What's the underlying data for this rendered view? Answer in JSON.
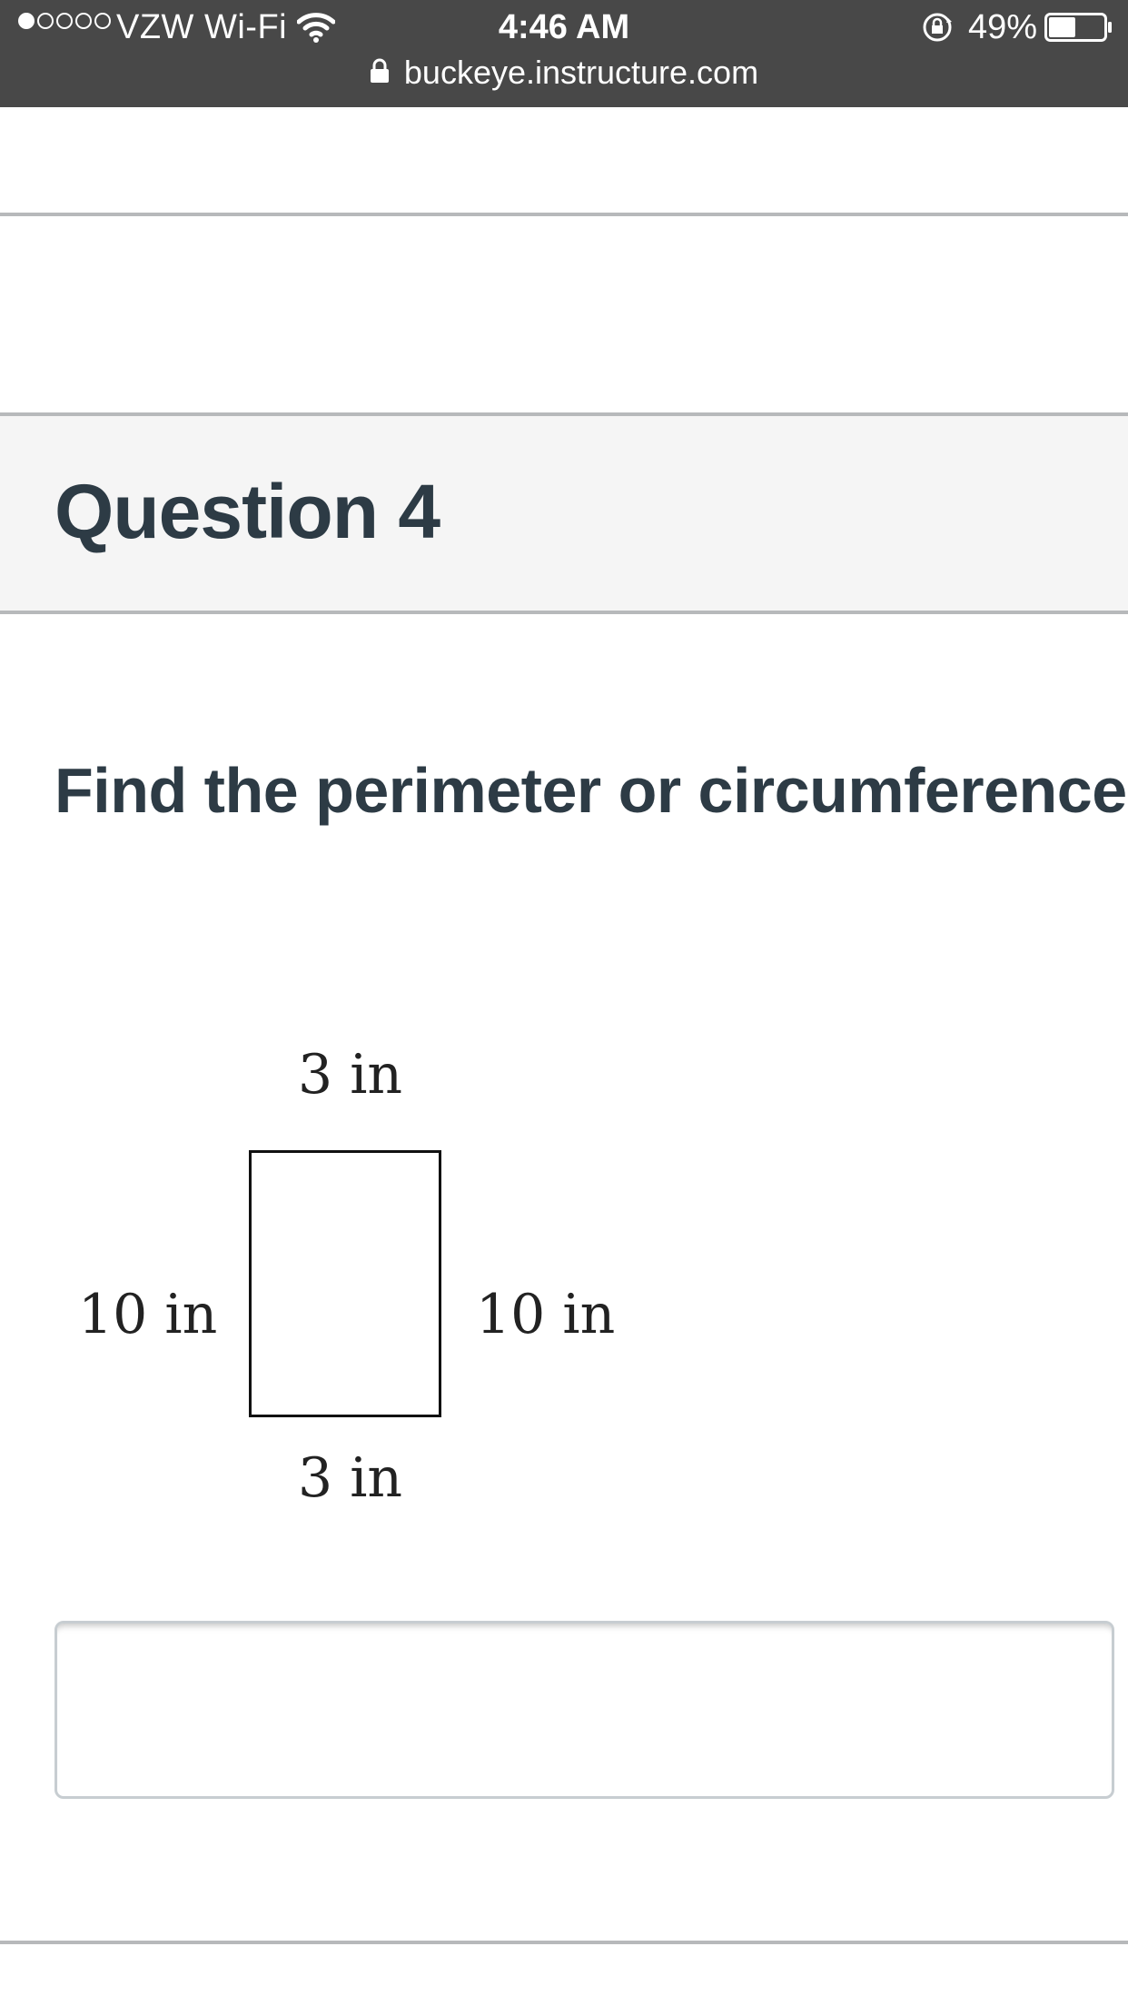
{
  "status_bar": {
    "carrier": "VZW Wi-Fi",
    "signal_bars_filled": 1,
    "signal_bars_total": 5,
    "time": "4:46 AM",
    "battery_percent": "49%",
    "battery_level": 0.49,
    "url": "buckeye.instructure.com",
    "icons": [
      "signal-dots-icon",
      "wifi-icon",
      "rotation-lock-icon",
      "battery-icon",
      "padlock-icon"
    ]
  },
  "question": {
    "title": "Question 4",
    "prompt": "Find the perimeter or circumference."
  },
  "figure": {
    "top_label": "3 in",
    "bottom_label": "3 in",
    "left_label": "10 in",
    "right_label": "10 in"
  },
  "answer": {
    "value": "",
    "placeholder": ""
  },
  "colors": {
    "status_bar_bg": "#484848",
    "heading_text": "#2d3b45",
    "header_bg": "#f5f5f5",
    "divider": "#b7b9bb"
  }
}
